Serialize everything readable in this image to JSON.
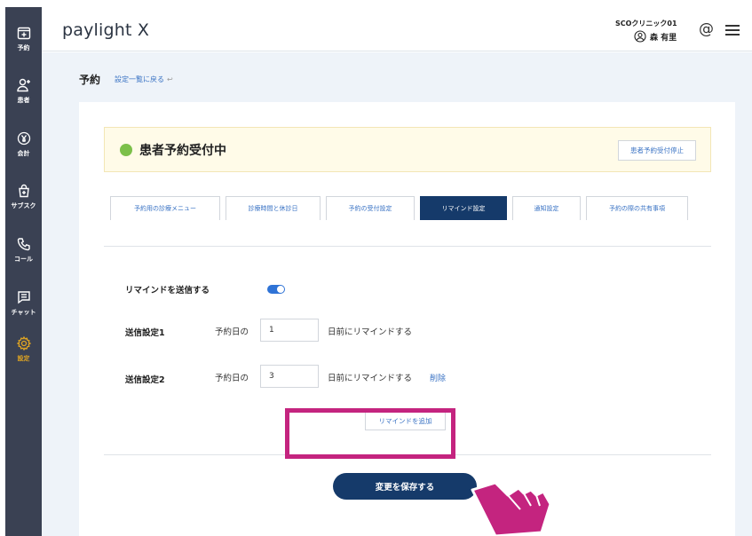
{
  "app": {
    "logo": "paylight X"
  },
  "sidebar": {
    "items": [
      {
        "label": "予約",
        "icon": "calendar-plus-icon",
        "active": false
      },
      {
        "label": "患者",
        "icon": "user-add-icon",
        "active": false
      },
      {
        "label": "会計",
        "icon": "yen-icon",
        "active": false
      },
      {
        "label": "サブスク",
        "icon": "bag-icon",
        "active": false
      },
      {
        "label": "コール",
        "icon": "phone-icon",
        "active": false
      },
      {
        "label": "チャット",
        "icon": "chat-icon",
        "active": false
      },
      {
        "label": "設定",
        "icon": "gear-icon",
        "active": true
      }
    ]
  },
  "header": {
    "clinic_name": "SCOクリニック01",
    "user_name": "森 有里",
    "at_icon": "@",
    "menu_icon": "hamburger-menu-icon"
  },
  "page": {
    "title": "予約",
    "back_link": "設定一覧に戻る",
    "back_arrow": "↩"
  },
  "status": {
    "text": "患者予約受付中",
    "stop_button": "患者予約受付停止",
    "dot_color": "#7cc04a"
  },
  "tabs": [
    {
      "label": "予約用の診療メニュー",
      "active": false
    },
    {
      "label": "診療時間と休診日",
      "active": false
    },
    {
      "label": "予約の受付設定",
      "active": false
    },
    {
      "label": "リマインド設定",
      "active": true
    },
    {
      "label": "通知設定",
      "active": false
    },
    {
      "label": "予約の際の共有事項",
      "active": false
    }
  ],
  "remind": {
    "send_label": "リマインドを送信する",
    "toggle_on": true,
    "setting1": {
      "label": "送信設定1",
      "prefix": "予約日の",
      "value": "1",
      "suffix": "日前にリマインドする"
    },
    "setting2": {
      "label": "送信設定2",
      "prefix": "予約日の",
      "value": "3",
      "suffix": "日前にリマインドする",
      "delete": "削除"
    },
    "add_button": "リマインドを追加"
  },
  "save_button": "変更を保存する",
  "colors": {
    "sidebar": "#3a4153",
    "primary": "#153a6a",
    "link": "#3a73c4",
    "highlight": "#c4247f",
    "active_nav": "#e0a522",
    "background": "#eef3f9"
  }
}
